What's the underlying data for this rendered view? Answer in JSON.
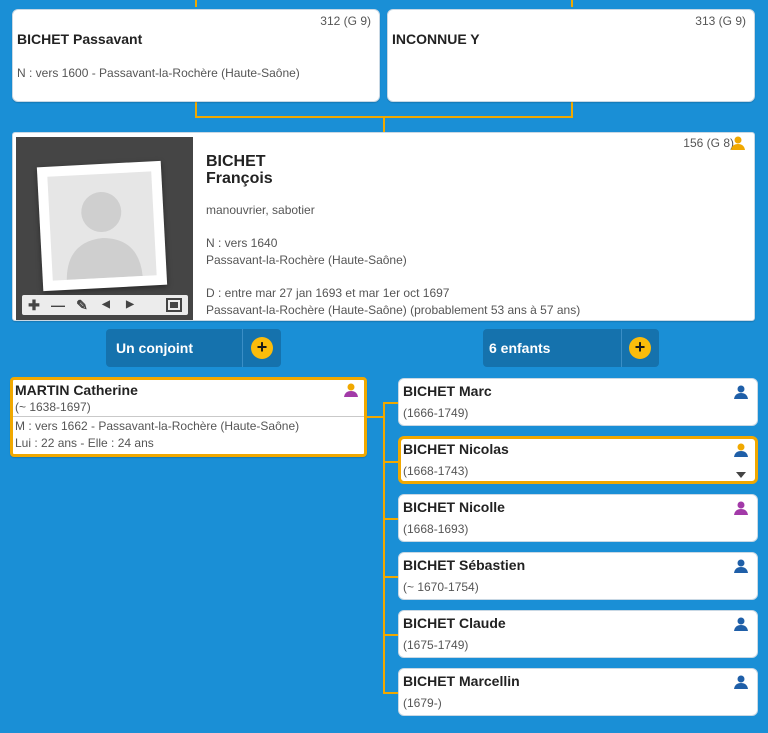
{
  "parents": [
    {
      "sosa": "312 (G 9)",
      "name": "BICHET Passavant",
      "birth": "N : vers 1600 - Passavant-la-Rochère (Haute-Saône)"
    },
    {
      "sosa": "313 (G 9)",
      "name": "INCONNUE Y"
    }
  ],
  "person": {
    "sosa": "156 (G 8)",
    "surname": "BICHET",
    "firstname": "François",
    "occupation": "manouvrier, sabotier",
    "birth_line1": "N : vers 1640",
    "birth_line2": "Passavant-la-Rochère (Haute-Saône)",
    "death_line1": "D : entre mar 27 jan 1693 et mar 1er oct 1697",
    "death_line2": "Passavant-la-Rochère (Haute-Saône) (probablement 53 ans à 57 ans)"
  },
  "spouses_pill": {
    "label": "Un conjoint",
    "plus": "+"
  },
  "children_pill": {
    "label": "6 enfants",
    "plus": "+"
  },
  "spouse": {
    "name": "MARTIN Catherine",
    "dates": "(~ 1638-1697)",
    "marriage": "M : vers 1662 - Passavant-la-Rochère (Haute-Saône)",
    "ages": "Lui : 22 ans - Elle : 24 ans"
  },
  "children": [
    {
      "name": "BICHET Marc",
      "dates": "(1666-1749)"
    },
    {
      "name": "BICHET Nicolas",
      "dates": "(1668-1743)"
    },
    {
      "name": "BICHET Nicolle",
      "dates": "(1668-1693)"
    },
    {
      "name": "BICHET Sébastien",
      "dates": "(~ 1670-1754)"
    },
    {
      "name": "BICHET Claude",
      "dates": "(1675-1749)"
    },
    {
      "name": "BICHET Marcellin",
      "dates": "(1679-)"
    }
  ],
  "colors": {
    "background": "#1a8fd6",
    "accent": "#f0a800",
    "male": "#1f5fa8",
    "female": "#a23aa8",
    "self": "#f0a800"
  },
  "icons": [
    "person-icon",
    "plus-icon",
    "minus-icon",
    "pencil-icon",
    "prev-icon",
    "next-icon",
    "film-icon",
    "chevron-down-icon"
  ]
}
